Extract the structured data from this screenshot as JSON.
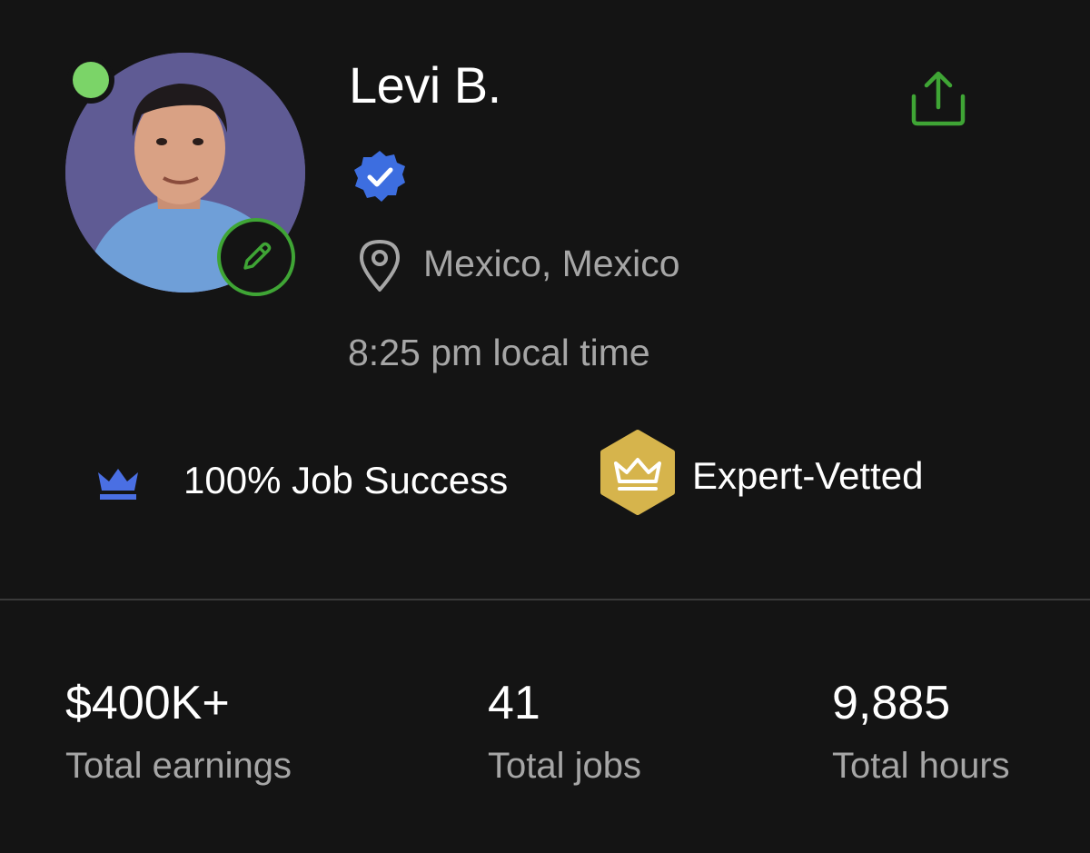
{
  "profile": {
    "name": "Levi B.",
    "location": "Mexico, Mexico",
    "local_time": "8:25 pm local time",
    "online_color": "#7bd468",
    "verified_color": "#3d6ee0"
  },
  "badges": {
    "job_success": "100% Job Success",
    "expert": "Expert-Vetted",
    "expert_color": "#d6b44c",
    "crown_color": "#4a6fe3"
  },
  "stats": [
    {
      "value": "$400K+",
      "label": "Total earnings"
    },
    {
      "value": "41",
      "label": "Total jobs"
    },
    {
      "value": "9,885",
      "label": "Total hours"
    }
  ],
  "icons": {
    "share": "share-icon",
    "edit": "pencil-icon",
    "location": "map-pin-icon",
    "verified": "verified-check-icon",
    "crown": "crown-icon"
  },
  "accent_green": "#3fa535"
}
